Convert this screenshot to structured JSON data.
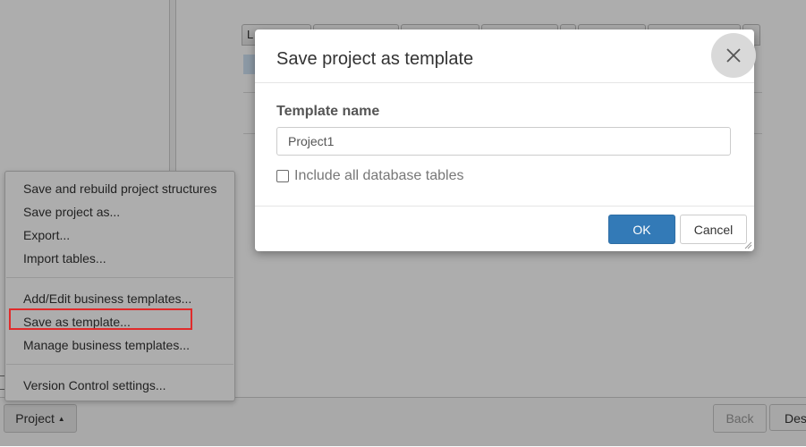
{
  "background": {
    "grid_columns": [
      "L",
      "",
      "",
      "",
      "",
      "",
      "",
      ""
    ],
    "bottom_buttons": {
      "back": "Back",
      "des": "Des"
    }
  },
  "project_button": {
    "label": "Project",
    "caret": "▲"
  },
  "project_menu": {
    "items": [
      "Save and rebuild project structures",
      "Save project as...",
      "Export...",
      "Import tables...",
      "Add/Edit business templates...",
      "Save as template...",
      "Manage business templates...",
      "Version Control settings..."
    ]
  },
  "dialog": {
    "title": "Save project as template",
    "field_label": "Template name",
    "template_name_value": "Project1",
    "checkbox_label": "Include all database tables",
    "checkbox_checked": false,
    "ok_label": "OK",
    "cancel_label": "Cancel",
    "close_icon": "close-icon"
  },
  "colors": {
    "primary": "#337ab7",
    "highlight": "#e02b2b",
    "overlay": "rgba(0,0,0,0.32)"
  }
}
